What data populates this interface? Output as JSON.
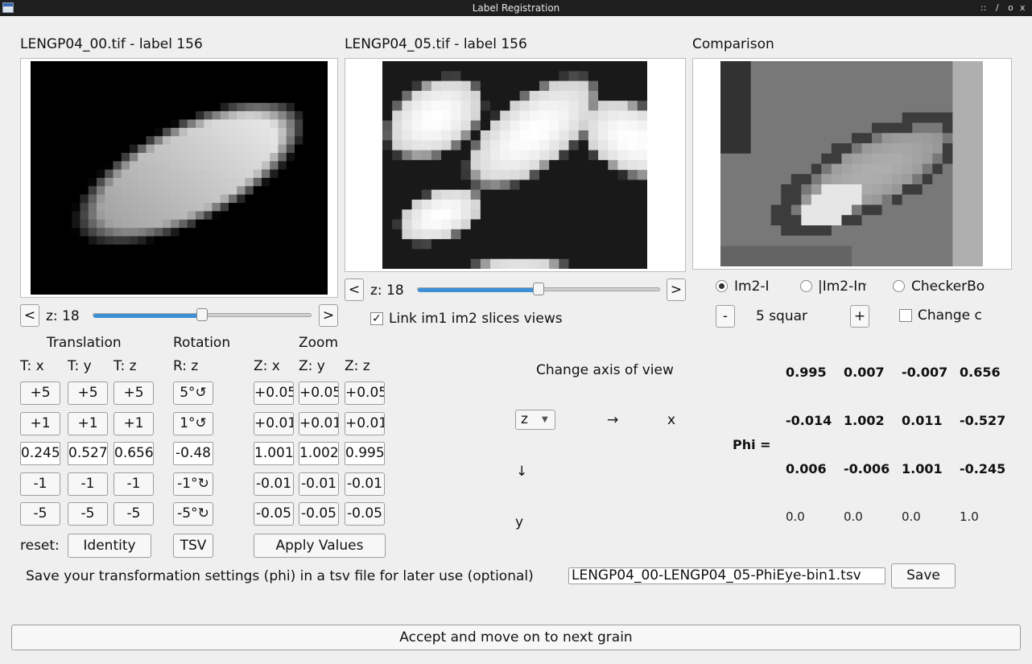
{
  "window": {
    "title": "Label Registration",
    "controls": [
      "::",
      "/",
      "o",
      "x"
    ]
  },
  "view1": {
    "title": "LENGP04_00.tif - label 156",
    "z_label": "z: 18",
    "z_fraction": 0.5,
    "prev": "<",
    "next": ">"
  },
  "view2": {
    "title": "LENGP04_05.tif - label 156",
    "z_label": "z: 18",
    "z_fraction": 0.5,
    "prev": "<",
    "next": ">",
    "link_label": "Link im1 im2 slices views",
    "link_checked": true
  },
  "comparison": {
    "title": "Comparison",
    "modes": [
      {
        "label": "Im2-I",
        "checked": true
      },
      {
        "label": "|Im2-Im",
        "checked": false
      },
      {
        "label": "CheckerBo",
        "checked": false
      }
    ],
    "minus": "-",
    "squares": "5 squar",
    "plus": "+",
    "change_label": "Change c",
    "change_checked": false
  },
  "transform": {
    "translation_header": "Translation",
    "rotation_header": "Rotation",
    "zoom_header": "Zoom",
    "columns": [
      {
        "label": "T: x",
        "buttons": [
          "+5",
          "+1",
          "-1",
          "-5"
        ],
        "value": "0.245"
      },
      {
        "label": "T: y",
        "buttons": [
          "+5",
          "+1",
          "-1",
          "-5"
        ],
        "value": "0.527"
      },
      {
        "label": "T: z",
        "buttons": [
          "+5",
          "+1",
          "-1",
          "-5"
        ],
        "value": "0.656"
      },
      {
        "label": "R: z",
        "buttons": [
          "5°↺",
          "1°↺",
          "-1°↻",
          "-5°↻"
        ],
        "value": "-0.48"
      },
      {
        "label": "Z: x",
        "buttons": [
          "+0.05",
          "+0.01",
          "-0.01",
          "-0.05"
        ],
        "value": "1.001"
      },
      {
        "label": "Z: y",
        "buttons": [
          "+0.05",
          "+0.01",
          "-0.01",
          "-0.05"
        ],
        "value": "1.002"
      },
      {
        "label": "Z: z",
        "buttons": [
          "+0.05",
          "+0.01",
          "-0.01",
          "-0.05"
        ],
        "value": "0.995"
      }
    ],
    "reset_label": "reset:",
    "identity": "Identity",
    "tsv": "TSV",
    "apply": "Apply Values"
  },
  "axis": {
    "title": "Change axis of view",
    "select": "z",
    "arrow_right": "→",
    "x_label": "x",
    "arrow_down": "↓",
    "y_label": "y"
  },
  "phi": {
    "label": "Phi =",
    "rows": [
      [
        "0.995",
        "0.007",
        "-0.007",
        "0.656"
      ],
      [
        "-0.014",
        "1.002",
        "0.011",
        "-0.527"
      ],
      [
        "0.006",
        "-0.006",
        "1.001",
        "-0.245"
      ],
      [
        "0.0",
        "0.0",
        "0.0",
        "1.0"
      ]
    ]
  },
  "save": {
    "label": "Save your transformation settings (phi) in a tsv file for later use (optional)",
    "filename": "LENGP04_00-LENGP04_05-PhiEye-bin1.tsv",
    "button": "Save"
  },
  "accept": "Accept and move on to next grain"
}
